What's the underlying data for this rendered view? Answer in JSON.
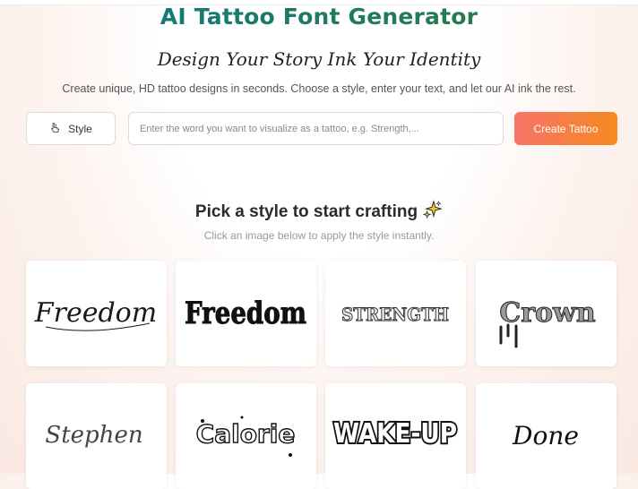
{
  "header": {
    "title": "AI Tattoo Font Generator",
    "slogan": "Design Your Story Ink Your Identity",
    "description": "Create unique, HD tattoo designs in seconds. Choose a style, enter your text, and let our AI ink the rest."
  },
  "toolbar": {
    "style_label": "Style",
    "input_placeholder": "Enter the word you want to visualize as a tattoo, e.g. Strength,...",
    "input_value": "",
    "create_label": "Create Tattoo"
  },
  "gallery": {
    "heading": "Pick a style to start crafting",
    "subheading": "Click an image below to apply the style instantly.",
    "cards": [
      {
        "text": "Freedom"
      },
      {
        "text": "Freedom"
      },
      {
        "text": "STRENGTH"
      },
      {
        "text": "Crown"
      },
      {
        "text": "Stephen"
      },
      {
        "text": "Calorie"
      },
      {
        "text": "WAKE-UP"
      },
      {
        "text": "Done"
      }
    ]
  },
  "colors": {
    "title_gradient_start": "#0f7a86",
    "title_gradient_end": "#2e7a3a",
    "create_gradient_start": "#f6736a",
    "create_gradient_end": "#f58a1f"
  }
}
